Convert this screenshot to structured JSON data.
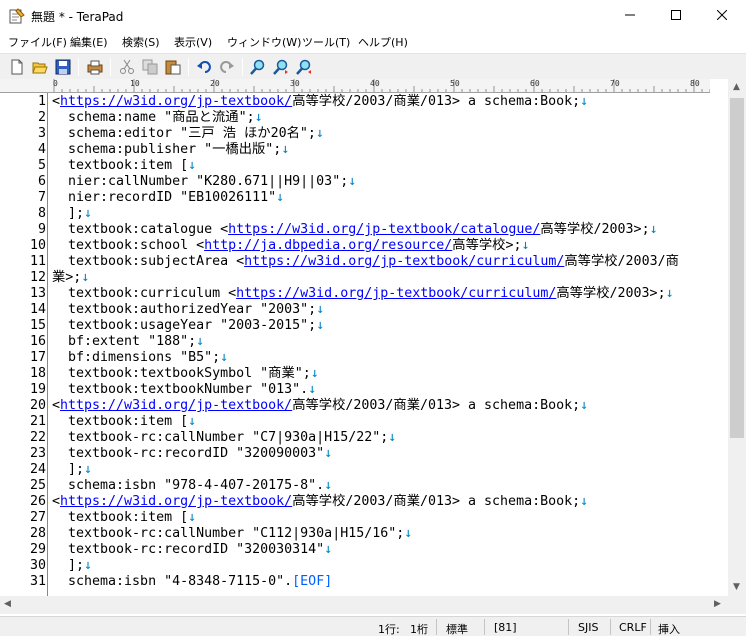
{
  "window": {
    "title": "無題 * - TeraPad"
  },
  "menu": [
    "ファイル(F)",
    "編集(E)",
    "検索(S)",
    "表示(V)",
    "ウィンドウ(W)",
    "ツール(T)",
    "ヘルプ(H)"
  ],
  "ruler": {
    "marks": [
      "0",
      "10",
      "20",
      "30",
      "40",
      "50",
      "60",
      "70",
      "80"
    ]
  },
  "editor": {
    "lines": [
      {
        "n": "1",
        "segs": [
          [
            "t",
            "<"
          ],
          [
            "l",
            "https://w3id.org/jp-textbook/"
          ],
          [
            "t",
            "高等学校/2003/商業/013> a schema:Book;"
          ],
          [
            "r",
            "↓"
          ]
        ]
      },
      {
        "n": "2",
        "segs": [
          [
            "t",
            "  schema:name \"商品と流通\";"
          ],
          [
            "r",
            "↓"
          ]
        ]
      },
      {
        "n": "3",
        "segs": [
          [
            "t",
            "  schema:editor \"三戸 浩 ほか20名\";"
          ],
          [
            "r",
            "↓"
          ]
        ]
      },
      {
        "n": "4",
        "segs": [
          [
            "t",
            "  schema:publisher \"一橋出版\";"
          ],
          [
            "r",
            "↓"
          ]
        ]
      },
      {
        "n": "5",
        "segs": [
          [
            "t",
            "  textbook:item ["
          ],
          [
            "r",
            "↓"
          ]
        ]
      },
      {
        "n": "6",
        "segs": [
          [
            "t",
            "  nier:callNumber \"K280.671||H9||03\";"
          ],
          [
            "r",
            "↓"
          ]
        ]
      },
      {
        "n": "7",
        "segs": [
          [
            "t",
            "  nier:recordID \"EB10026111\""
          ],
          [
            "r",
            "↓"
          ]
        ]
      },
      {
        "n": "8",
        "segs": [
          [
            "t",
            "  ];"
          ],
          [
            "r",
            "↓"
          ]
        ]
      },
      {
        "n": "9",
        "segs": [
          [
            "t",
            "  textbook:catalogue <"
          ],
          [
            "l",
            "https://w3id.org/jp-textbook/catalogue/"
          ],
          [
            "t",
            "高等学校/2003>;"
          ],
          [
            "r",
            "↓"
          ]
        ]
      },
      {
        "n": "10",
        "segs": [
          [
            "t",
            "  textbook:school <"
          ],
          [
            "l",
            "http://ja.dbpedia.org/resource/"
          ],
          [
            "t",
            "高等学校>;"
          ],
          [
            "r",
            "↓"
          ]
        ]
      },
      {
        "n": "11",
        "segs": [
          [
            "t",
            "  textbook:subjectArea <"
          ],
          [
            "l",
            "https://w3id.org/jp-textbook/curriculum/"
          ],
          [
            "t",
            "高等学校/2003/商"
          ]
        ]
      },
      {
        "n": "12",
        "segs": [
          [
            "t",
            "業>;"
          ],
          [
            "r",
            "↓"
          ]
        ]
      },
      {
        "n": "13",
        "segs": [
          [
            "t",
            "  textbook:curriculum <"
          ],
          [
            "l",
            "https://w3id.org/jp-textbook/curriculum/"
          ],
          [
            "t",
            "高等学校/2003>;"
          ],
          [
            "r",
            "↓"
          ]
        ]
      },
      {
        "n": "14",
        "segs": [
          [
            "t",
            "  textbook:authorizedYear \"2003\";"
          ],
          [
            "r",
            "↓"
          ]
        ]
      },
      {
        "n": "15",
        "segs": [
          [
            "t",
            "  textbook:usageYear \"2003-2015\";"
          ],
          [
            "r",
            "↓"
          ]
        ]
      },
      {
        "n": "16",
        "segs": [
          [
            "t",
            "  bf:extent \"188\";"
          ],
          [
            "r",
            "↓"
          ]
        ]
      },
      {
        "n": "17",
        "segs": [
          [
            "t",
            "  bf:dimensions \"B5\";"
          ],
          [
            "r",
            "↓"
          ]
        ]
      },
      {
        "n": "18",
        "segs": [
          [
            "t",
            "  textbook:textbookSymbol \"商業\";"
          ],
          [
            "r",
            "↓"
          ]
        ]
      },
      {
        "n": "19",
        "segs": [
          [
            "t",
            "  textbook:textbookNumber \"013\"."
          ],
          [
            "r",
            "↓"
          ]
        ]
      },
      {
        "n": "20",
        "segs": [
          [
            "t",
            "<"
          ],
          [
            "l",
            "https://w3id.org/jp-textbook/"
          ],
          [
            "t",
            "高等学校/2003/商業/013> a schema:Book;"
          ],
          [
            "r",
            "↓"
          ]
        ]
      },
      {
        "n": "21",
        "segs": [
          [
            "t",
            "  textbook:item ["
          ],
          [
            "r",
            "↓"
          ]
        ]
      },
      {
        "n": "22",
        "segs": [
          [
            "t",
            "  textbook-rc:callNumber \"C7|930a|H15/22\";"
          ],
          [
            "r",
            "↓"
          ]
        ]
      },
      {
        "n": "23",
        "segs": [
          [
            "t",
            "  textbook-rc:recordID \"320090003\""
          ],
          [
            "r",
            "↓"
          ]
        ]
      },
      {
        "n": "24",
        "segs": [
          [
            "t",
            "  ];"
          ],
          [
            "r",
            "↓"
          ]
        ]
      },
      {
        "n": "25",
        "segs": [
          [
            "t",
            "  schema:isbn \"978-4-407-20175-8\"."
          ],
          [
            "r",
            "↓"
          ]
        ]
      },
      {
        "n": "26",
        "segs": [
          [
            "t",
            "<"
          ],
          [
            "l",
            "https://w3id.org/jp-textbook/"
          ],
          [
            "t",
            "高等学校/2003/商業/013> a schema:Book;"
          ],
          [
            "r",
            "↓"
          ]
        ]
      },
      {
        "n": "27",
        "segs": [
          [
            "t",
            "  textbook:item ["
          ],
          [
            "r",
            "↓"
          ]
        ]
      },
      {
        "n": "28",
        "segs": [
          [
            "t",
            "  textbook-rc:callNumber \"C112|930a|H15/16\";"
          ],
          [
            "r",
            "↓"
          ]
        ]
      },
      {
        "n": "29",
        "segs": [
          [
            "t",
            "  textbook-rc:recordID \"320030314\""
          ],
          [
            "r",
            "↓"
          ]
        ]
      },
      {
        "n": "30",
        "segs": [
          [
            "t",
            "  ];"
          ],
          [
            "r",
            "↓"
          ]
        ]
      },
      {
        "n": "31",
        "segs": [
          [
            "t",
            "  schema:isbn \"4-8348-7115-0\"."
          ],
          [
            "e",
            "[EOF]"
          ]
        ]
      }
    ]
  },
  "status": {
    "line": "1行:",
    "col": "1桁",
    "mode": "標準",
    "code": "[81]",
    "encoding": "SJIS",
    "newline": "CRLF",
    "insert": "挿入"
  }
}
